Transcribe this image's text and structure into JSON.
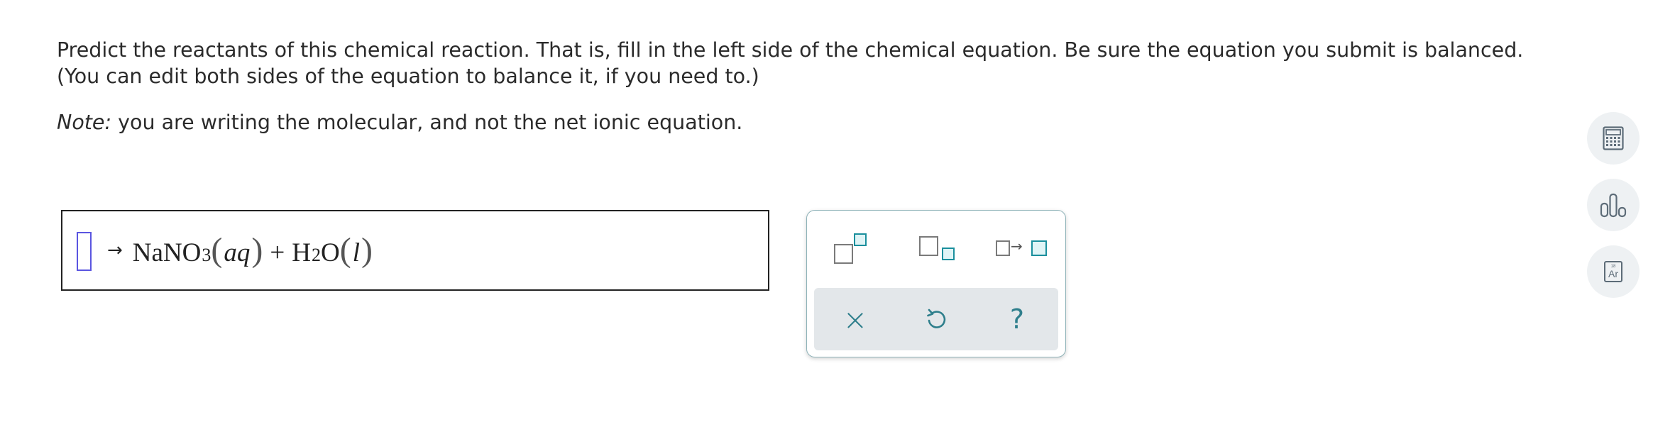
{
  "instructions": {
    "line1": "Predict the reactants of this chemical reaction. That is, fill in the left side of the chemical equation. Be sure the equation you submit is balanced.",
    "line2": "(You can edit both sides of the equation to balance it, if you need to.)",
    "note_label": "Note:",
    "note_text": " you are writing the molecular, and not the net ionic equation."
  },
  "equation": {
    "arrow": "→",
    "product1": {
      "symbol": "NaNO",
      "subscript": "3",
      "phase": "aq"
    },
    "plus": "+",
    "product2": {
      "symbol_a": "H",
      "subscript": "2",
      "symbol_b": "O",
      "phase": "l"
    }
  },
  "toolbar": {
    "tools": [
      "superscript-tool",
      "subscript-tool",
      "reaction-arrow-tool"
    ],
    "arrow_glyph": "→",
    "actions": {
      "clear": "×",
      "help": "?"
    }
  },
  "side_tools": {
    "periodic_number": "18",
    "periodic_symbol": "Ar"
  },
  "colors": {
    "accent_teal": "#1a8f9d",
    "cursor_purple": "#5a55e0",
    "toolbar_bg": "#e3e7ea",
    "side_button_bg": "#eef1f3"
  }
}
